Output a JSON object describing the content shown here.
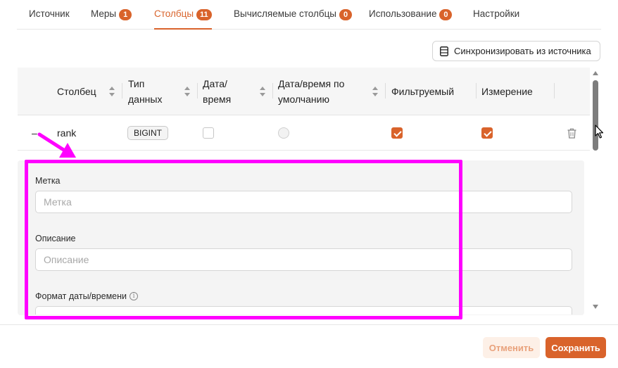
{
  "tabs": [
    {
      "label": "Источник",
      "badge": null,
      "active": false
    },
    {
      "label": "Меры",
      "badge": "1",
      "active": false
    },
    {
      "label": "Столбцы",
      "badge": "11",
      "active": true
    },
    {
      "label": "Вычисляемые столбцы",
      "badge": "0",
      "active": false
    },
    {
      "label": "Использование",
      "badge": "0",
      "active": false
    },
    {
      "label": "Настройки",
      "badge": null,
      "active": false
    }
  ],
  "sync_button": {
    "label": "Синхронизировать из источника",
    "icon": "database-icon"
  },
  "table": {
    "columns": [
      {
        "label": "Столбец"
      },
      {
        "label": "Тип\nданных"
      },
      {
        "label": "Дата/\nвремя"
      },
      {
        "label": "Дата/время по\nумолчанию"
      },
      {
        "label": "Фильтруемый"
      },
      {
        "label": "Измерение"
      }
    ],
    "rows": [
      {
        "collapse_symbol": "–",
        "name": "rank",
        "type": "BIGINT",
        "is_datetime": false,
        "default_datetime": false,
        "filterable": true,
        "dimension": true,
        "delete_icon": "trash-icon"
      }
    ]
  },
  "details": {
    "label_field": {
      "label": "Метка",
      "placeholder": "Метка",
      "value": ""
    },
    "description_field": {
      "label": "Описание",
      "placeholder": "Описание",
      "value": ""
    },
    "datetime_format_field": {
      "label": "Формат даты/времени",
      "info_icon": "info-icon",
      "info_glyph": "i"
    }
  },
  "footer": {
    "cancel_label": "Отменить",
    "save_label": "Сохранить"
  },
  "colors": {
    "accent": "#d9632b",
    "highlight": "#ff00ff",
    "cancel_bg": "#fdf0e7"
  }
}
